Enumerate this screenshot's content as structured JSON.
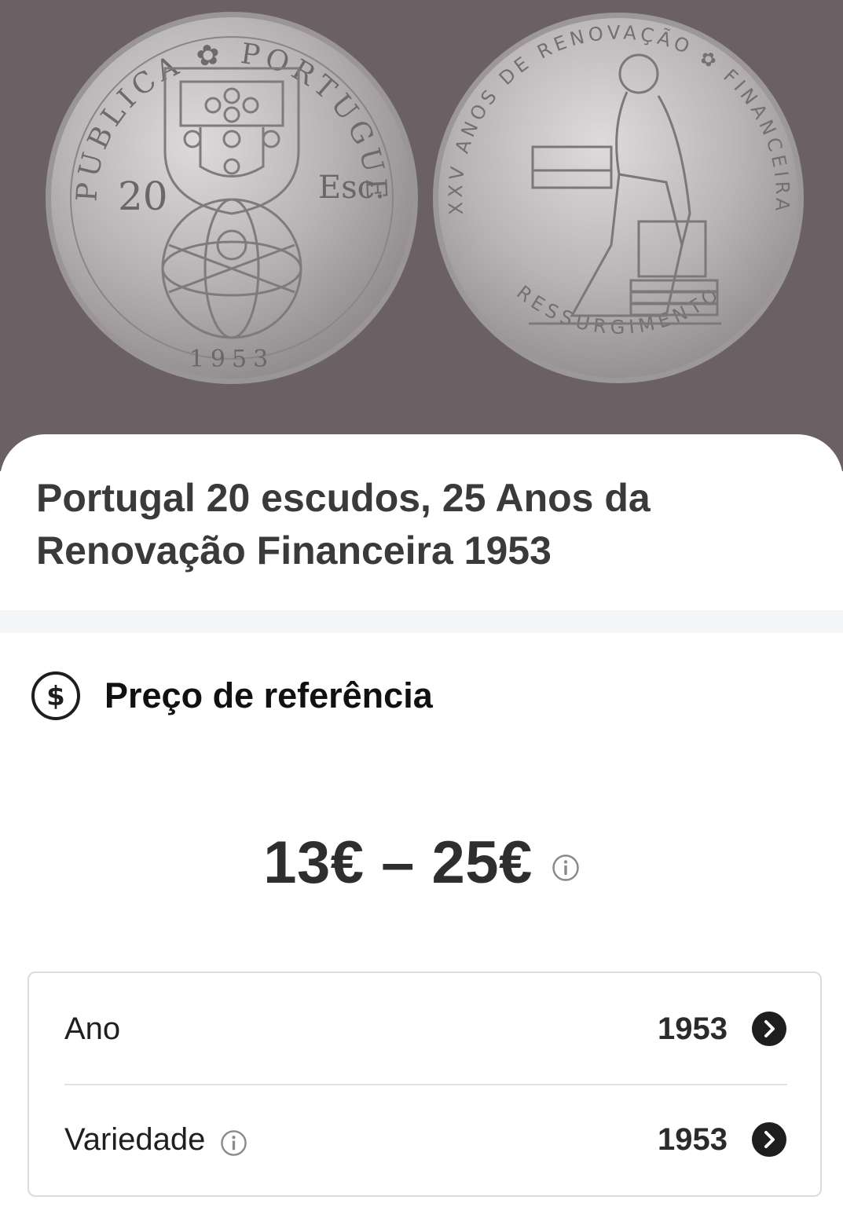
{
  "coin": {
    "obverse_legend_top": "REPUBLICA ✿ PORTUGUESA",
    "obverse_denomination": "20",
    "obverse_currency": "Esc.",
    "obverse_year": "1953",
    "reverse_legend": "XXV ANOS DE RENOVAÇÃO ✿ FINANCEIRA",
    "reverse_legend_bottom": "RESSURGIMENTO"
  },
  "title_lines": [
    "Portugal 20 escudos, 25 Anos da",
    "Renovação Financeira 1953"
  ],
  "reference": {
    "label": "Preço de referência",
    "icon": "dollar-circle-icon",
    "price_range": "13€ – 25€"
  },
  "details": [
    {
      "label": "Ano",
      "value": "1953",
      "has_info": false
    },
    {
      "label": "Variedade",
      "value": "1953",
      "has_info": true
    }
  ],
  "colors": {
    "hero_background": "#6b6164",
    "coin_silver": "#b9b6b7",
    "divider_band": "#f2f6f9",
    "chevron_button": "#1e1e1e"
  }
}
